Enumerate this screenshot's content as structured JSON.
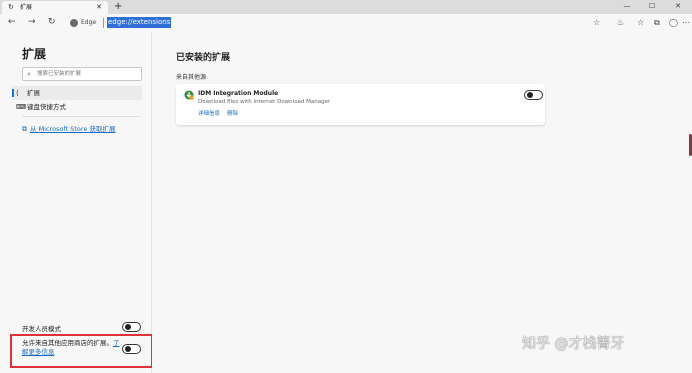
{
  "tab": {
    "icon": "refresh-icon",
    "title": "扩展",
    "close": "✕"
  },
  "new_tab_label": "+",
  "window_controls": {
    "minimize": "—",
    "maximize": "☐",
    "close": "✕"
  },
  "address": {
    "back": "←",
    "forward": "→",
    "reload": "↻",
    "browser_label": "Edge",
    "url": "edge://extensions"
  },
  "toolbar_icons": [
    "star-icon",
    "collections-icon",
    "favorites-icon",
    "share-icon",
    "profile-icon",
    "more-icon"
  ],
  "toolbar_glyphs": {
    "star": "☆",
    "collections": "♨",
    "favorites": "☆",
    "share": "⧉",
    "profile": "◯",
    "more": "⋯"
  },
  "sidebar": {
    "title": "扩展",
    "search_placeholder": "搜索已安装的扩展",
    "search_icon": "⌕",
    "items": [
      {
        "label": "扩展",
        "icon": "extension-icon",
        "glyph": "⟨",
        "active": true
      },
      {
        "label": "键盘快捷方式",
        "icon": "keyboard-icon",
        "glyph": "⌨",
        "active": false
      }
    ],
    "store_link": "从 Microsoft Store 获取扩展",
    "store_icon": "⧉",
    "dev_mode_label": "开发人员模式",
    "dev_mode_on": false,
    "allow_text": "允许来自其他应用商店的扩展。",
    "allow_link": "了解更多信息",
    "allow_on": false
  },
  "main": {
    "title": "已安装的扩展",
    "section": "来自其他源",
    "extension": {
      "name": "IDM Integration Module",
      "description": "Download files with Internet Download Manager",
      "details_link": "详细信息",
      "remove_link": "删除",
      "enabled": false
    }
  },
  "watermark": "知乎 @才栈箐牙",
  "colors": {
    "accent": "#1a6bc2",
    "url_highlight": "#2f6fd8",
    "annotation_box": "#e0303a"
  }
}
